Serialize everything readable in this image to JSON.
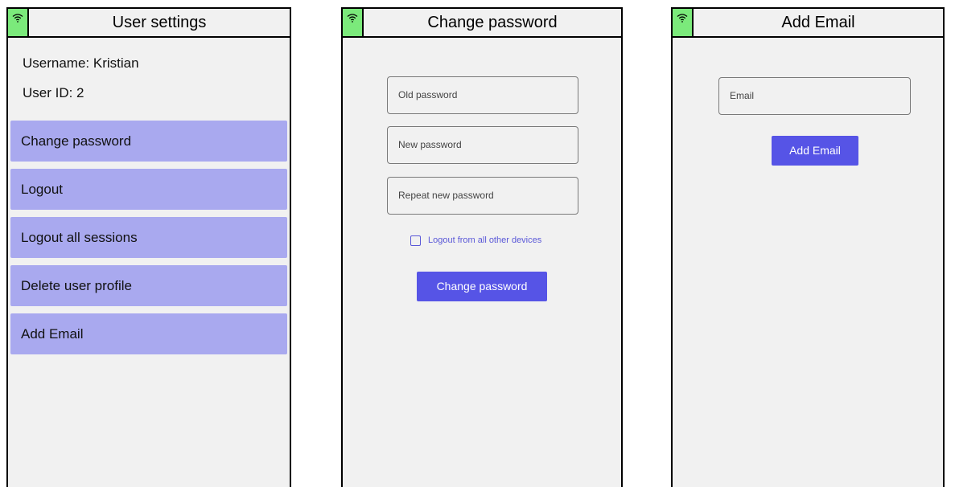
{
  "screens": {
    "user_settings": {
      "title": "User settings",
      "username": "Username:  Kristian",
      "user_id": "User ID:  2",
      "menu": [
        {
          "label": "Change password"
        },
        {
          "label": "Logout"
        },
        {
          "label": "Logout all sessions"
        },
        {
          "label": "Delete user profile"
        },
        {
          "label": "Add Email"
        }
      ]
    },
    "change_password": {
      "title": "Change password",
      "old_password_placeholder": "Old password",
      "new_password_placeholder": "New password",
      "repeat_password_placeholder": "Repeat new password",
      "logout_others_label": "Logout from all other devices",
      "logout_others_checked": false,
      "submit_label": "Change password"
    },
    "add_email": {
      "title": "Add Email",
      "email_placeholder": "Email",
      "submit_label": "Add Email"
    }
  },
  "icons": {
    "status": "wifi-icon"
  },
  "colors": {
    "status_green": "#7bea7b",
    "menu_item": "#a9a9ef",
    "primary": "#5654e6",
    "background": "#f1f1f1"
  }
}
